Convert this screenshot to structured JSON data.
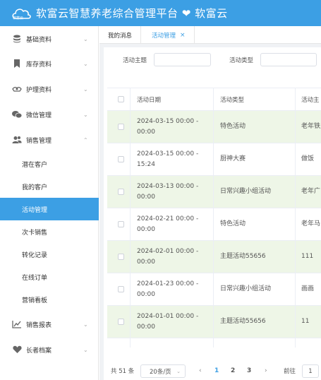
{
  "header": {
    "logo_text": "软富云",
    "title": "软富云智慧养老综合管理平台 ❤ 软富云"
  },
  "sidebar": {
    "items": [
      {
        "label": "基础资料",
        "icon": "database-icon",
        "chevron": "⌄"
      },
      {
        "label": "库存资料",
        "icon": "bookmark-icon",
        "chevron": "⌄"
      },
      {
        "label": "护理资料",
        "icon": "care-icon",
        "chevron": "⌄"
      },
      {
        "label": "微信管理",
        "icon": "wechat-icon",
        "chevron": "⌄"
      },
      {
        "label": "销售管理",
        "icon": "users-icon",
        "chevron": "⌃"
      }
    ],
    "sub_items": [
      {
        "label": "潜在客户"
      },
      {
        "label": "我的客户"
      },
      {
        "label": "活动管理"
      },
      {
        "label": "次卡销售"
      },
      {
        "label": "转化记录"
      },
      {
        "label": "在线订单"
      },
      {
        "label": "营销看板"
      }
    ],
    "bottom_items": [
      {
        "label": "销售报表",
        "icon": "line-chart-icon",
        "chevron": "⌄"
      },
      {
        "label": "长者档案",
        "icon": "heart-icon",
        "chevron": "⌄"
      }
    ]
  },
  "tabs": [
    {
      "label": "我的消息"
    },
    {
      "label": "活动管理",
      "close": "×"
    }
  ],
  "filter": {
    "theme_label": "活动主题",
    "type_label": "活动类型",
    "theme_value": "",
    "type_value": ""
  },
  "table": {
    "columns": [
      "活动日期",
      "活动类型",
      "活动主"
    ],
    "rows": [
      {
        "date": "2024-03-15 00:00 - 00:00",
        "type": "特色活动",
        "theme": "老年铁人"
      },
      {
        "date": "2024-03-15 00:00 - 15:24",
        "type": "厨神大赛",
        "theme": "做饭"
      },
      {
        "date": "2024-03-13 00:00 - 00:00",
        "type": "日常兴趣小组活动",
        "theme": "老年广"
      },
      {
        "date": "2024-02-21 00:00 - 00:00",
        "type": "特色活动",
        "theme": "老年马"
      },
      {
        "date": "2024-02-01 00:00 - 00:00",
        "type": "主题活动55656",
        "theme": "111"
      },
      {
        "date": "2024-01-23 00:00 - 00:00",
        "type": "日常兴趣小组活动",
        "theme": "画画"
      },
      {
        "date": "2024-01-01 00:00 - 00:00",
        "type": "主题活动55656",
        "theme": "11"
      }
    ]
  },
  "pager": {
    "total": "共 51 条",
    "page_size": "20条/页",
    "pages": [
      "1",
      "2",
      "3"
    ],
    "current": "1",
    "goto_label": "前往",
    "goto_value": "1"
  }
}
